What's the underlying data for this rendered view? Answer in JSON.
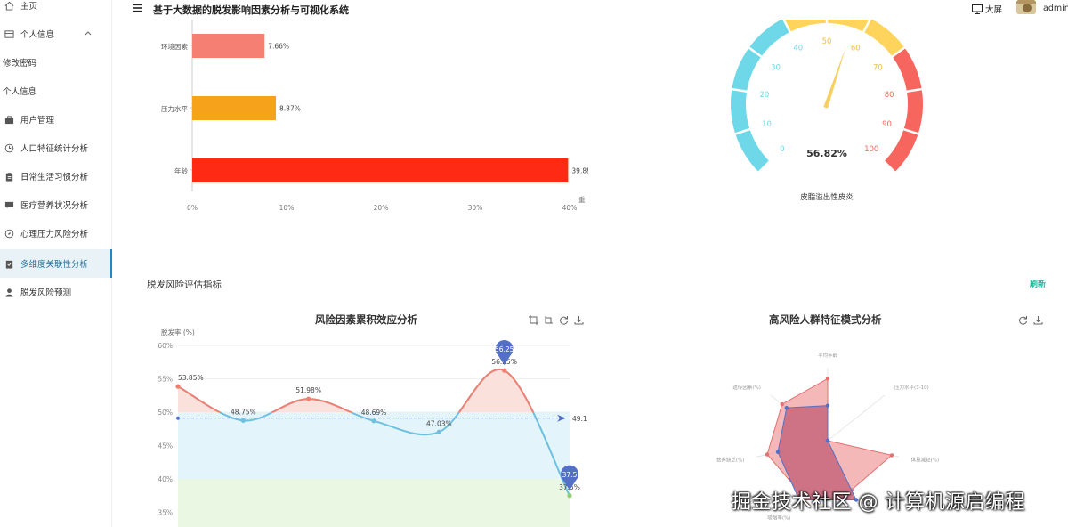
{
  "header": {
    "title": "基于大数据的脱发影响因素分析与可视化系统",
    "screen_label": "大屏",
    "user": "admin"
  },
  "sidebar": {
    "items": [
      {
        "label": "主页",
        "icon": "home-icon"
      },
      {
        "label": "个人信息",
        "icon": "person-card-icon"
      },
      {
        "label": "修改密码",
        "icon": ""
      },
      {
        "label": "个人信息",
        "icon": ""
      },
      {
        "label": "用户管理",
        "icon": "briefcase-icon"
      },
      {
        "label": "人口特征统计分析",
        "icon": "clock-icon"
      },
      {
        "label": "日常生活习惯分析",
        "icon": "clipboard-icon"
      },
      {
        "label": "医疗营养状况分析",
        "icon": "chat-icon"
      },
      {
        "label": "心理压力风险分析",
        "icon": "compass-icon"
      },
      {
        "label": "多维度关联性分析",
        "icon": "task-icon"
      },
      {
        "label": "脱发风险预测",
        "icon": "user-icon"
      }
    ]
  },
  "section": {
    "title": "脱发风险评估指标",
    "refresh": "刷新"
  },
  "colors": {
    "accent": "#1e88c8",
    "refresh": "#1abc9c",
    "bar1": "#f47f72",
    "bar2": "#f7a21b",
    "bar3": "#ff2a14",
    "gauge_low": "#6fd8e8",
    "gauge_mid": "#ffd45c",
    "gauge_high": "#f7665e",
    "line_blue": "#6fc0df",
    "line_red": "#f08070",
    "radar_fill": "#c96c80"
  },
  "importance_chart": {
    "categories": [
      "环境因素",
      "压力水平",
      "年龄"
    ],
    "values": [
      7.66,
      8.87,
      39.85
    ],
    "value_labels": [
      "7.66%",
      "8.87%",
      "39.8!"
    ],
    "x_ticks": [
      "0%",
      "10%",
      "20%",
      "30%",
      "40%"
    ],
    "xlim": [
      0,
      40
    ],
    "axis_name": "重"
  },
  "gauge": {
    "value": 56.82,
    "value_label": "56.82%",
    "ticks": [
      "0",
      "10",
      "20",
      "30",
      "40",
      "50",
      "60",
      "70",
      "80",
      "90",
      "100"
    ],
    "name": "皮脂溢出性皮炎"
  },
  "chart_data": [
    {
      "type": "line",
      "title": "风险因素累积效应分析",
      "ylabel": "脱发率 (%)",
      "y_ticks": [
        "35%",
        "40%",
        "45%",
        "50%",
        "55%",
        "60%"
      ],
      "ylim": [
        32,
        60
      ],
      "values": [
        53.85,
        48.75,
        51.98,
        48.69,
        47.03,
        56.25,
        37.5
      ],
      "point_labels": [
        "53.85%",
        "48.75%",
        "51.98%",
        "48.69%",
        "47.03%",
        "56.25%",
        "37.5%"
      ],
      "max_pin": "56.25",
      "min_pin": "37.5",
      "average": 49.1,
      "average_label": "49.1"
    },
    {
      "type": "radar",
      "title": "高风险人群特征模式分析",
      "indicators": [
        "平均年龄",
        "压力水平(1-10)",
        "体重减轻(%)",
        "",
        "吸烟率(%)",
        "营养缺乏(%)",
        "遗传因素(%)"
      ],
      "series": [
        {
          "values": [
            0.85,
            0,
            0.9,
            0.75,
            0.82,
            0.85,
            0.8
          ]
        },
        {
          "values": [
            0.48,
            0,
            0,
            0.9,
            0.9,
            0.7,
            0.72
          ]
        }
      ]
    }
  ],
  "watermark": "掘金技术社区 @ 计算机源启编程"
}
